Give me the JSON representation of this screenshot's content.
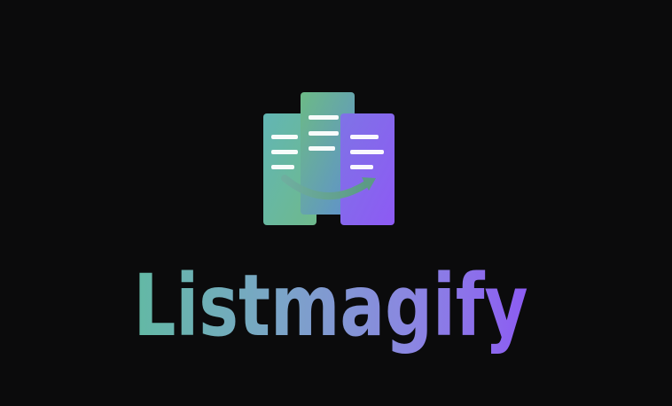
{
  "brand": {
    "name": "Listmagify",
    "colors": {
      "teal": "#5fb8a6",
      "green": "#6fb58a",
      "blue": "#6f8fd6",
      "purple": "#8b5cf6",
      "background": "#0b0b0c",
      "line": "#ffffff"
    },
    "icon": "list-columns-with-arrow-icon"
  }
}
